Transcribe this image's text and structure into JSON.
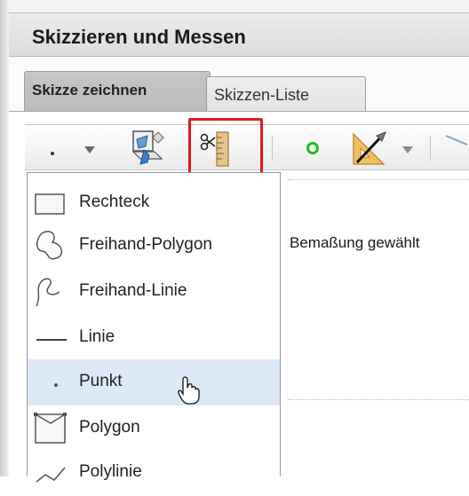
{
  "panel": {
    "title": "Skizzieren und Messen"
  },
  "tabs": [
    {
      "label": "Skizze zeichnen",
      "active": true
    },
    {
      "label": "Skizzen-Liste",
      "active": false
    }
  ],
  "toolbar": {
    "items": [
      {
        "icon": "point-draw-icon"
      },
      {
        "icon": "dropdown-arrow-icon"
      },
      {
        "icon": "sketch-edit-icon"
      },
      {
        "icon": "ruler-scissors-icon",
        "highlighted": true
      },
      {
        "icon": "green-circle-icon"
      },
      {
        "icon": "angle-ruler-icon"
      },
      {
        "icon": "dropdown-arrow-icon"
      }
    ],
    "highlight_color": "#e3181f"
  },
  "menu": {
    "items": [
      {
        "label": "Rechteck",
        "icon": "rectangle-icon"
      },
      {
        "label": "Freihand-Polygon",
        "icon": "freehand-polygon-icon"
      },
      {
        "label": "Freihand-Linie",
        "icon": "freehand-line-icon"
      },
      {
        "label": "Linie",
        "icon": "line-icon"
      },
      {
        "label": "Punkt",
        "icon": "point-icon",
        "selected": true
      },
      {
        "label": "Polygon",
        "icon": "polygon-icon"
      },
      {
        "label": "Polylinie",
        "icon": "polyline-icon"
      }
    ],
    "selected_color": "#dde9f6"
  },
  "content": {
    "text": "Bemaßung gewählt"
  }
}
